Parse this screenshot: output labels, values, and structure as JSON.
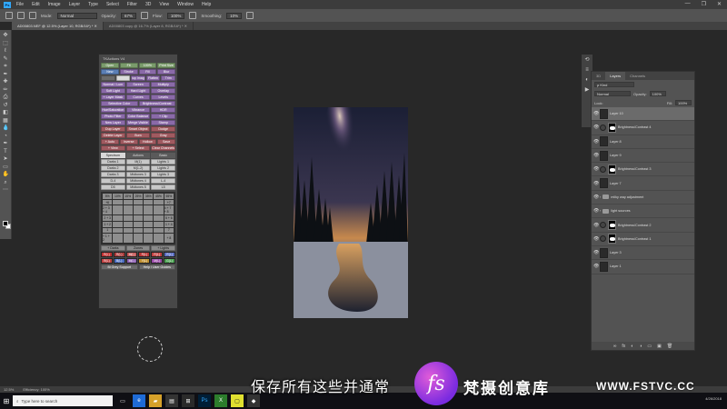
{
  "app": {
    "logo": "Ps"
  },
  "menu": [
    "File",
    "Edit",
    "Image",
    "Layer",
    "Type",
    "Select",
    "Filter",
    "3D",
    "View",
    "Window",
    "Help"
  ],
  "window_controls": [
    "—",
    "❐",
    "✕"
  ],
  "options_bar": {
    "mode_label": "Mode:",
    "mode_value": "Normal",
    "opacity_label": "Opacity:",
    "opacity_value": "67%",
    "flow_label": "Flow:",
    "flow_value": "100%",
    "smoothing_label": "Smoothing:",
    "smoothing_value": "10%"
  },
  "doc_tabs": [
    {
      "label": "AD00803.NEF @ 12.5% (Layer 10, RGB/16*) * ✕",
      "active": true
    },
    {
      "label": "AD00803 copy @ 16.7% (Layer 8, RGB/16*) * ✕",
      "active": false
    }
  ],
  "ext_panel": {
    "title": "TKActions V4",
    "rows": [
      [
        {
          "l": "Open",
          "c": "green"
        },
        {
          "l": "Fit",
          "c": "green"
        },
        {
          "l": "100%",
          "c": "green"
        },
        {
          "l": "Print Size",
          "c": "green"
        }
      ],
      [
        {
          "l": "New",
          "c": "blue"
        },
        {
          "l": "Stroke",
          "c": "purple"
        },
        {
          "l": "Fill",
          "c": "purple"
        },
        {
          "l": "Blur",
          "c": "purple"
        }
      ],
      [
        {
          "l": "",
          "c": "dark"
        },
        {
          "l": "",
          "c": "white"
        },
        {
          "l": "Dup Image",
          "c": "purple"
        },
        {
          "l": "Flatten",
          "c": "purple"
        },
        {
          "l": "Trim",
          "c": "purple"
        }
      ],
      [
        {
          "l": "Normal / Lum",
          "c": "purple"
        },
        {
          "l": "Screen",
          "c": "purple"
        },
        {
          "l": "Multiply",
          "c": "purple"
        }
      ],
      [
        {
          "l": "Soft Light",
          "c": "purple"
        },
        {
          "l": "Hard Light",
          "c": "purple"
        },
        {
          "l": "Overlay",
          "c": "purple"
        }
      ],
      [
        {
          "l": "+ Layer Mask",
          "c": "purple"
        },
        {
          "l": "Curves",
          "c": "purple"
        },
        {
          "l": "Levels",
          "c": "purple"
        }
      ],
      [
        {
          "l": "Selective Color",
          "c": "purple"
        },
        {
          "l": "Brightness/Contrast",
          "c": "purple"
        }
      ],
      [
        {
          "l": "Hue/Saturation",
          "c": "purple"
        },
        {
          "l": "Vibrance",
          "c": "purple"
        },
        {
          "l": "HDR",
          "c": "purple"
        }
      ],
      [
        {
          "l": "Photo Filter",
          "c": "purple"
        },
        {
          "l": "Color Balance",
          "c": "purple"
        },
        {
          "l": "+ Clip",
          "c": "purple"
        }
      ],
      [
        {
          "l": "New Layer",
          "c": "purple"
        },
        {
          "l": "Merge Visible",
          "c": "purple"
        },
        {
          "l": "Stamp",
          "c": "purple"
        }
      ],
      [
        {
          "l": "Dup Layer",
          "c": "red"
        },
        {
          "l": "Smart Object",
          "c": "red"
        },
        {
          "l": "Dodge",
          "c": "red"
        }
      ],
      [
        {
          "l": "Delete Layer",
          "c": "red"
        },
        {
          "l": "Burn",
          "c": "red"
        },
        {
          "l": "Gray",
          "c": "red"
        }
      ],
      [
        {
          "l": "+ Auto",
          "c": "red"
        },
        {
          "l": "Inverse",
          "c": "red"
        },
        {
          "l": "Hollow",
          "c": "red"
        },
        {
          "l": "Save",
          "c": "red"
        }
      ],
      [
        {
          "l": "+ View",
          "c": "red"
        },
        {
          "l": "+ Select",
          "c": "red"
        },
        {
          "l": "Clear Channels",
          "c": "red"
        }
      ]
    ],
    "section_tabs": [
      {
        "l": "Spectrum",
        "active": true
      },
      {
        "l": "Actions",
        "active": false
      },
      {
        "l": "Basic",
        "active": false
      }
    ],
    "lum_rows": [
      [
        {
          "l": "Darks 1",
          "c": "light"
        },
        {
          "l": "M(1)",
          "c": "light"
        },
        {
          "l": "Lights 1",
          "c": "light"
        }
      ],
      [
        {
          "l": "Darks 2",
          "c": "light"
        },
        {
          "l": "M(1-2)",
          "c": "light"
        },
        {
          "l": "Lights 2",
          "c": "light"
        }
      ],
      [
        {
          "l": "Darks 3",
          "c": "light"
        },
        {
          "l": "Midtones 3",
          "c": "light"
        },
        {
          "l": "Lights 3",
          "c": "light"
        }
      ],
      [
        {
          "l": "D-4",
          "c": "light"
        },
        {
          "l": "Midtones 4",
          "c": "light"
        },
        {
          "l": "L-4",
          "c": "light"
        }
      ],
      [
        {
          "l": "D5",
          "c": "light"
        },
        {
          "l": "Midtones 5",
          "c": "light"
        },
        {
          "l": "L5",
          "c": "light"
        }
      ]
    ],
    "zone_grid": [
      "5%",
      "10%",
      "15%",
      "25%",
      "35%",
      "45%",
      "55%",
      "+6",
      "",
      "",
      "",
      "",
      "",
      "+7",
      "2 + 3 + 4",
      "",
      "",
      "",
      "",
      "",
      "4 + 7 + 8",
      "2 + 3",
      "",
      "",
      "",
      "",
      "",
      "5 + 6",
      "1 + 2",
      "",
      "",
      "",
      "",
      "",
      "1 + 4",
      "1",
      "",
      "",
      "",
      "",
      "",
      "7",
      "+ 1 + 2",
      "",
      "",
      "",
      "",
      "",
      "+ 8"
    ],
    "bottom_rows": [
      [
        {
          "l": "+ Darks",
          "c": "gray"
        },
        {
          "l": "Zones",
          "c": "gray"
        },
        {
          "l": "+ Lights",
          "c": "gray"
        }
      ]
    ],
    "color_chips": [
      {
        "l": "R(L)",
        "c": "#c03030"
      },
      {
        "l": "R(L)",
        "c": "#a83a3a"
      },
      {
        "l": "M(L)",
        "c": "#c05050"
      },
      {
        "l": "R(L)",
        "c": "#b83535"
      },
      {
        "l": "R(L)",
        "c": "#c14040"
      },
      {
        "l": "R(L)",
        "c": "#5a6cc0"
      },
      {
        "l": "R(L)",
        "c": "#c04040"
      },
      {
        "l": "B(L)",
        "c": "#4a6cc0"
      },
      {
        "l": "M(L)",
        "c": "#8a5ab0"
      },
      {
        "l": "Y(L)",
        "c": "#c09030"
      },
      {
        "l": "M(L)",
        "c": "#9a4aa8"
      },
      {
        "l": "G(L)",
        "c": "#4aa050"
      }
    ],
    "footer_buttons": [
      {
        "l": "Bl Grey Support",
        "c": "dark"
      },
      {
        "l": "Help / User Guides",
        "c": "dark"
      }
    ]
  },
  "layers_panel": {
    "tabs": [
      {
        "l": "3D",
        "active": false
      },
      {
        "l": "Layers",
        "active": true
      },
      {
        "l": "Channels",
        "active": false
      }
    ],
    "kind_label": "ρ Kind",
    "blend_mode": "Normal",
    "opacity_label": "Opacity:",
    "opacity_value": "100%",
    "lock_label": "Lock:",
    "fill_label": "Fill:",
    "fill_value": "100%",
    "layers": [
      {
        "name": "Layer 10",
        "type": "pixel",
        "selected": true
      },
      {
        "name": "Brightness/Contrast 4",
        "type": "adj",
        "selected": false
      },
      {
        "name": "Layer 8",
        "type": "pixel",
        "selected": false
      },
      {
        "name": "Layer 9",
        "type": "pixel",
        "selected": false
      },
      {
        "name": "Brightness/Contrast 3",
        "type": "adj",
        "selected": false
      },
      {
        "name": "Layer 7",
        "type": "pixel",
        "selected": false
      },
      {
        "name": "milky way adjustment",
        "type": "folder",
        "selected": false
      },
      {
        "name": "light sources",
        "type": "folder",
        "selected": false
      },
      {
        "name": "Brightness/Contrast 2",
        "type": "adj",
        "selected": false
      },
      {
        "name": "Brightness/Contrast 1",
        "type": "adj",
        "selected": false
      },
      {
        "name": "Layer 3",
        "type": "pixel",
        "selected": false
      },
      {
        "name": "Layer 1",
        "type": "pixel",
        "selected": false
      }
    ],
    "footer_icons": [
      "∞",
      "fx",
      "◐",
      "◑",
      "▭",
      "▣",
      "🗑"
    ]
  },
  "status_bar": {
    "zoom": "12.5%",
    "info": "Efficiency: 100%"
  },
  "taskbar": {
    "search_placeholder": "Type here to search",
    "time": "4/26/2018"
  },
  "subtitle": "保存所有这些并通常",
  "watermark": {
    "logo_text": "fs",
    "text": "梵摄创意库",
    "url": "WWW.FSTVC.CC"
  },
  "colors": {
    "accent": "#31a8ff",
    "panel": "#535353",
    "canvas": "#282828"
  }
}
